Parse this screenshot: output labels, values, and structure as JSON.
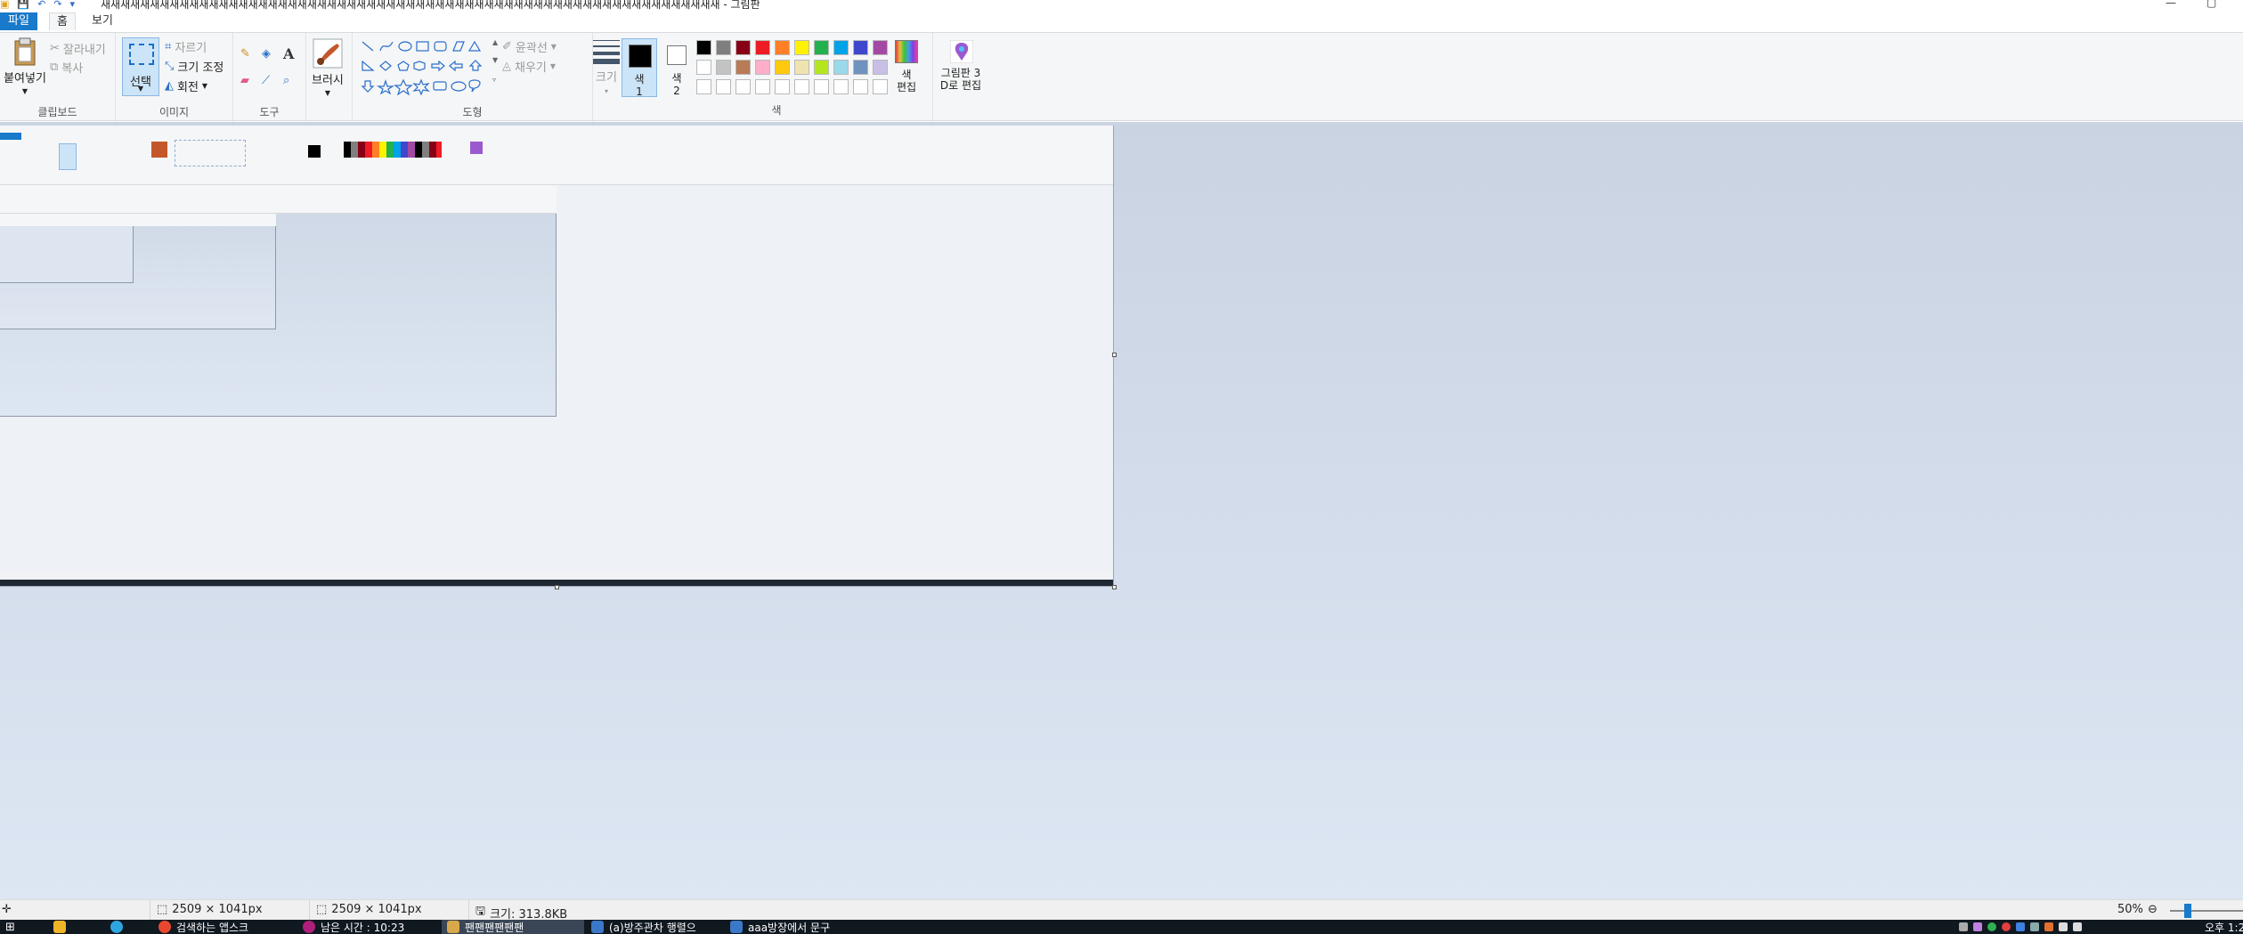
{
  "window": {
    "title": "새새새새새새새새새새새새새새새새새새새새새새새새새새새새새새새새새새새새새새새새새새새새새새새새새새새새새새새새새새새새새새새 - 그림판",
    "minimize": "—",
    "maximize": "▢"
  },
  "tabs": {
    "file": "파일",
    "home": "홈",
    "view": "보기"
  },
  "ribbon": {
    "clipboard": {
      "label": "클립보드",
      "paste": "붙여넣기",
      "cut": "잘라내기",
      "copy": "복사"
    },
    "image": {
      "label": "이미지",
      "select": "선택",
      "crop": "자르기",
      "resize": "크기 조정",
      "rotate": "회전"
    },
    "tools": {
      "label": "도구"
    },
    "brushes": {
      "label": "브러시"
    },
    "shapes": {
      "label": "도형",
      "outline": "윤곽선",
      "fill": "채우기"
    },
    "size": {
      "label": "크기"
    },
    "colors": {
      "label": "색",
      "color1": "색\n1",
      "color2": "색\n2",
      "edit": "색\n편집",
      "paint3d": "그림판 3\nD로 편집",
      "accent": "#1979ca"
    }
  },
  "palette_row1": [
    "#000000",
    "#7f7f7f",
    "#880015",
    "#ed1c24",
    "#ff7f27",
    "#fff200",
    "#22b14c",
    "#00a2e8",
    "#3f48cc",
    "#a349a4"
  ],
  "palette_row2": [
    "#ffffff",
    "#c3c3c3",
    "#b97a57",
    "#ffaec9",
    "#ffc90e",
    "#efe4b0",
    "#b5e61d",
    "#99d9ea",
    "#7092be",
    "#c8bfe7"
  ],
  "status": {
    "cursor": "",
    "selection": "2509 × 1041px",
    "canvas_size": "2509 × 1041px",
    "file_size": "크기: 313.8KB",
    "zoom": "50%"
  },
  "taskbar": {
    "items": [
      "검색하는 앱스크",
      "남은 시간 : 10:23",
      "팬팬팬팬팬팬",
      "(a)방주관차 행렬으",
      "aaa방장에서 문구"
    ],
    "clock": "오후 1:2"
  }
}
